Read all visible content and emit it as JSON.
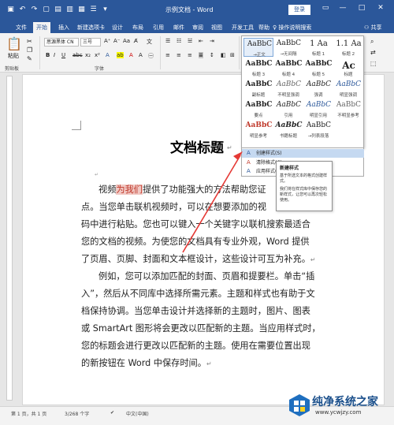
{
  "title_bar": {
    "doc_title": "示例文档 - Word",
    "login": "登录",
    "qat_icons": [
      "save-icon",
      "undo-icon",
      "redo-icon",
      "new-icon",
      "open-icon",
      "print-icon",
      "view-icon",
      "touch-icon",
      "more-icon"
    ]
  },
  "tabs": [
    "文件",
    "开始",
    "插入",
    "新建选项卡",
    "设计",
    "布局",
    "引用",
    "邮件",
    "审阅",
    "视图",
    "开发工具",
    "帮助"
  ],
  "active_tab": "开始",
  "help_search": "操作说明搜索",
  "share": "共享",
  "ribbon": {
    "paste": "粘贴",
    "clipboard_group": "剪贴板",
    "font_group": "字体",
    "font_name": "思源黑体 CN",
    "font_size": "三号"
  },
  "styles_gallery": [
    {
      "sample": "AaBbC",
      "name": "→正文"
    },
    {
      "sample": "AaBbC",
      "name": "→无间隔"
    },
    {
      "sample": "1 Aa",
      "name": "标题 1"
    },
    {
      "sample": "1.1 Aa",
      "name": "标题 2"
    },
    {
      "sample": "AaBbC",
      "name": "标题 3"
    },
    {
      "sample": "AaBbC",
      "name": "标题 4"
    },
    {
      "sample": "AaBbC",
      "name": "标题 5"
    },
    {
      "sample": "Ac",
      "name": "标题"
    },
    {
      "sample": "AaBbC",
      "name": "副标题"
    },
    {
      "sample": "AaBbC",
      "name": "不明显强调"
    },
    {
      "sample": "AaBbC",
      "name": "强调"
    },
    {
      "sample": "AaBbC",
      "name": "明显强调"
    },
    {
      "sample": "AaBbC",
      "name": "要点"
    },
    {
      "sample": "AaBbC",
      "name": "引用"
    },
    {
      "sample": "AaBbC",
      "name": "明显引用"
    },
    {
      "sample": "AaBbC",
      "name": "不明显参考"
    },
    {
      "sample": "AaBbC",
      "name": "明显参考"
    },
    {
      "sample": "AaBbC",
      "name": "书籍标题"
    },
    {
      "sample": "AaBbC",
      "name": "→列表段落"
    }
  ],
  "styles_menu": [
    {
      "label": "创建样式(S)",
      "icon": "create-style-icon"
    },
    {
      "label": "清除格式(C)",
      "icon": "clear-format-icon"
    },
    {
      "label": "应用样式(A)...",
      "icon": "apply-styles-icon"
    }
  ],
  "tooltip": {
    "title": "新建样式",
    "lines": [
      "基于所选文本的格式创建样式。",
      "我们将在样式库中保存您的新样式，让您可以再次轻松使用。"
    ]
  },
  "document": {
    "heading": "文档标题",
    "para1": [
      {
        "pre": "视频",
        "hl": "为我们",
        "post": "提供了功能强大的方法帮助您证"
      },
      {
        "text": "点。当您单击联机视频时，可以在想要添加的视"
      },
      {
        "text": "码中进行粘贴。您也可以键入一个关键字以联机搜索最适合"
      },
      {
        "text": "您的文档的视频。为使您的文档具有专业外观，Word 提供"
      },
      {
        "text": "了页眉、页脚、封面和文本框设计，这些设计可互为补充。"
      }
    ],
    "para2": [
      {
        "text": "例如，您可以添加匹配的封面、页眉和提要栏。单击“插"
      },
      {
        "text": "入”，然后从不同库中选择所需元素。主题和样式也有助于文"
      },
      {
        "text": "档保持协调。当您单击设计并选择新的主题时，图片、图表"
      },
      {
        "text": "或 SmartArt 图形将会更改以匹配新的主题。当应用样式时，"
      },
      {
        "text": "您的标题会进行更改以匹配新的主题。使用在需要位置出现"
      },
      {
        "text": "的新按钮在 Word 中保存时间。"
      }
    ]
  },
  "status": {
    "page": "第 1 页，共 1 页",
    "words": "3/268 个字",
    "lang": "中文(中国)"
  },
  "watermark": {
    "brand": "纯净系统之家",
    "url": "www.ycwjzy.com"
  },
  "colors": {
    "accent": "#2b579a",
    "highlight": "#f1c9c4",
    "arrow": "#e53935"
  }
}
